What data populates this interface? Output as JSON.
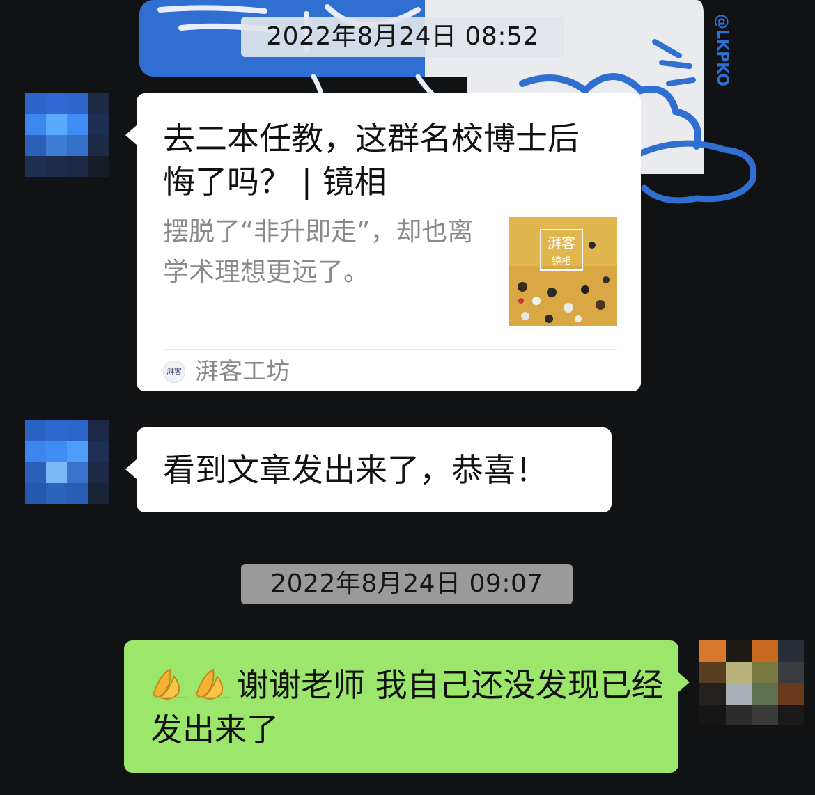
{
  "chat": {
    "timestamps": [
      "2022年8月24日 08:52",
      "2022年8月24日 09:07"
    ],
    "wallpaper_watermark": "@LKPKO",
    "link_card": {
      "title": "去二本任教，这群名校博士后悔了吗？ | 镜相",
      "description": "摆脱了“非升即走”，却也离学术理想更远了。",
      "thumbnail_label": "湃客",
      "thumbnail_sublabel": "镜相",
      "source_logo_text": "湃客",
      "source_name": "湃客工坊"
    },
    "incoming_message": "看到文章发出来了，恭喜！",
    "outgoing_message": {
      "emoji": "folded-hands-emoji",
      "text": "谢谢老师 我自己还没发现已经发出来了"
    }
  },
  "colors": {
    "background": "#111214",
    "incoming_bubble": "#ffffff",
    "outgoing_bubble": "#9be66b",
    "timestamp_bg_1": "#e1e4eb",
    "timestamp_bg_2": "#9a9a9a"
  }
}
